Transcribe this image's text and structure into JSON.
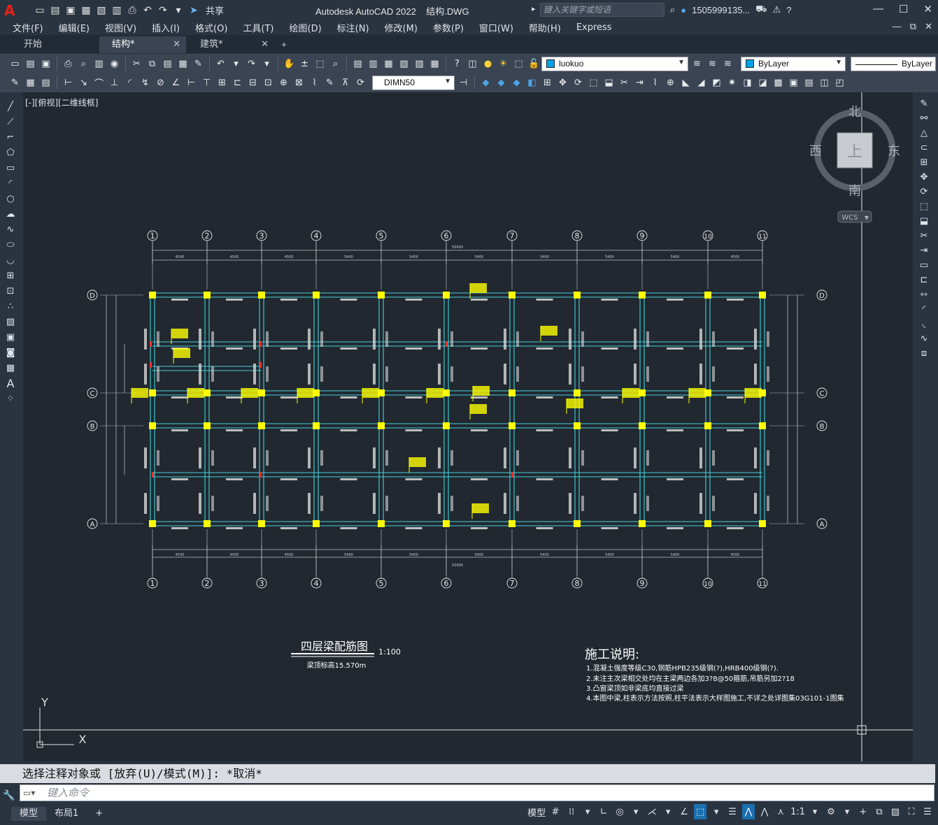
{
  "app": {
    "title": "Autodesk AutoCAD 2022    结构.DWG",
    "share_label": "共享",
    "search_placeholder": "键入关键字或短语",
    "user": "1505999135...",
    "menus": [
      "文件(F)",
      "编辑(E)",
      "视图(V)",
      "插入(I)",
      "格式(O)",
      "工具(T)",
      "绘图(D)",
      "标注(N)",
      "修改(M)",
      "参数(P)",
      "窗口(W)",
      "帮助(H)",
      "Express"
    ]
  },
  "tabs": [
    {
      "label": "开始",
      "active": false,
      "closable": false
    },
    {
      "label": "结构*",
      "active": true,
      "closable": true
    },
    {
      "label": "建筑*",
      "active": false,
      "closable": true
    }
  ],
  "toolbar": {
    "layer_name": "luokuo",
    "color_value": "ByLayer",
    "linetype_value": "ByLayer",
    "dimstyle_value": "DIMN50"
  },
  "viewport": {
    "label": "[-][俯视][二维线框]",
    "viewcube": {
      "north": "北",
      "south": "南",
      "east": "东",
      "west": "西",
      "top": "上",
      "wcs": "WCS"
    },
    "ucs": {
      "x": "X",
      "y": "Y"
    }
  },
  "drawing": {
    "col_axes": [
      "1",
      "2",
      "3",
      "4",
      "5",
      "6",
      "7",
      "8",
      "9",
      "10",
      "11"
    ],
    "row_axes": [
      "D",
      "C",
      "B",
      "A"
    ],
    "spans": [
      "4500",
      "4500",
      "4500",
      "5400",
      "5400",
      "5400",
      "5400",
      "5400",
      "5400",
      "4500"
    ],
    "total_length": "50400",
    "title": "四层梁配筋图",
    "scale": "1:100",
    "elevation": "梁顶标高15.570m",
    "notes_title": "施工说明:",
    "notes": [
      "1.混凝土强度等级C30,钢筋HPB235级钢(?),HRB400级钢(?).",
      "2.未注主次梁相交处均在主梁两边各加3?8@50箍筋,吊筋另加2?18",
      "3.凸窗梁顶如非梁底均直接过梁",
      "4.本图中梁,柱表示方法按照,柱平法表示大样图施工,不详之处详图集03G101-1图集"
    ]
  },
  "command": {
    "history": "选择注释对象或 [放弃(U)/模式(M)]: *取消*",
    "placeholder": "键入命令"
  },
  "status": {
    "layout_tabs": [
      "模型",
      "布局1"
    ],
    "model_label": "模型",
    "scale_label": "1:1"
  }
}
